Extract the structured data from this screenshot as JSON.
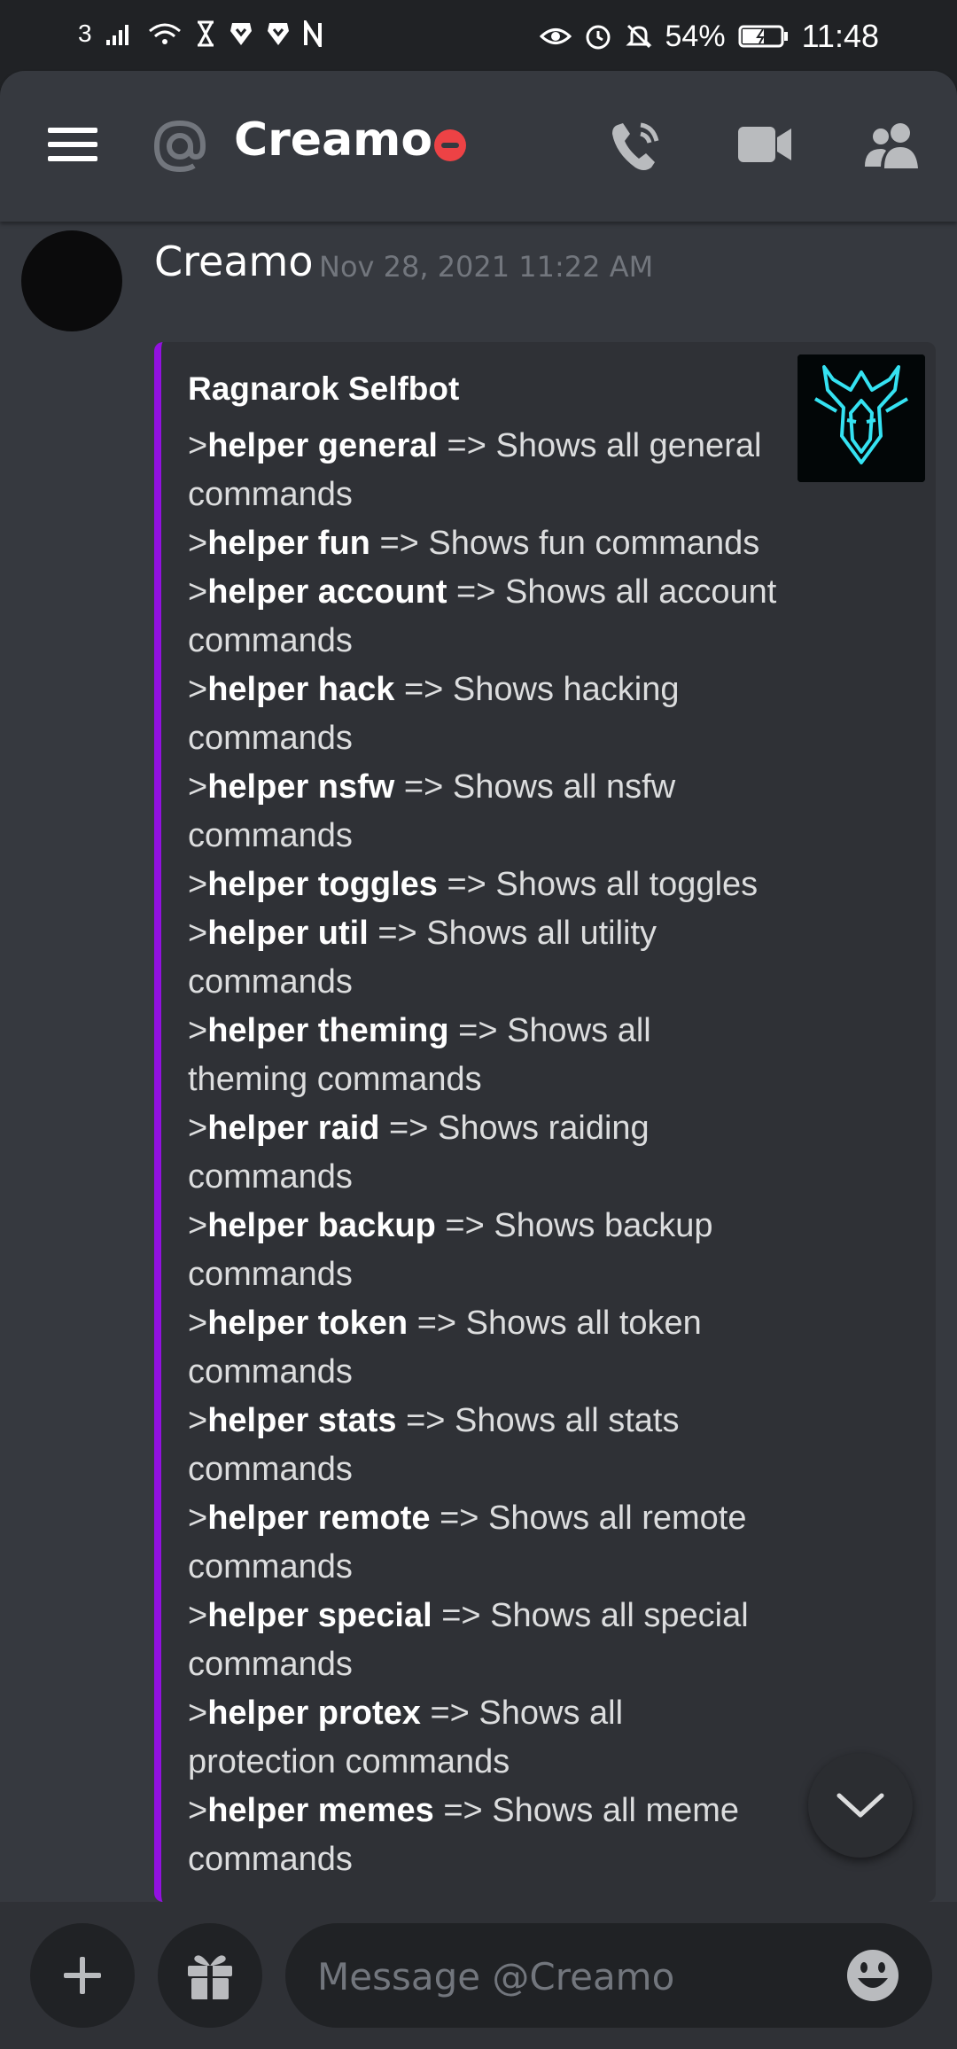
{
  "status_bar": {
    "sim": "3",
    "battery_percent": "54%",
    "time": "11:48"
  },
  "header": {
    "title": "Creamo",
    "menu_icon": "hamburger-icon",
    "at_icon": "at-icon",
    "status": "do-not-disturb",
    "call_icon": "phone-call-icon",
    "video_icon": "video-camera-icon",
    "members_icon": "members-icon"
  },
  "message": {
    "author": "Creamo",
    "timestamp": "Nov 28, 2021 11:22 AM",
    "embed": {
      "accent_color": "#9211e0",
      "title": "Ragnarok Selfbot",
      "lines": [
        {
          "prefix": ">",
          "command": "helper general",
          "desc": " => Shows all general",
          "wrap": "commands"
        },
        {
          "prefix": ">",
          "command": "helper fun",
          "desc": " => Shows fun commands",
          "wrap": ""
        },
        {
          "prefix": ">",
          "command": "helper account",
          "desc": " => Shows all account",
          "wrap": "commands"
        },
        {
          "prefix": ">",
          "command": "helper hack",
          "desc": " => Shows hacking",
          "wrap": "commands"
        },
        {
          "prefix": ">",
          "command": "helper nsfw",
          "desc": " => Shows all nsfw",
          "wrap": "commands"
        },
        {
          "prefix": ">",
          "command": "helper toggles",
          "desc": " => Shows all toggles",
          "wrap": ""
        },
        {
          "prefix": ">",
          "command": "helper util",
          "desc": " => Shows all utility",
          "wrap": "commands"
        },
        {
          "prefix": ">",
          "command": "helper theming",
          "desc": " => Shows all",
          "wrap": "theming commands"
        },
        {
          "prefix": ">",
          "command": "helper raid",
          "desc": " => Shows raiding",
          "wrap": "commands"
        },
        {
          "prefix": ">",
          "command": "helper backup",
          "desc": " => Shows backup",
          "wrap": "commands"
        },
        {
          "prefix": ">",
          "command": "helper token",
          "desc": " => Shows all token",
          "wrap": "commands"
        },
        {
          "prefix": ">",
          "command": "helper stats",
          "desc": " => Shows all stats",
          "wrap": "commands"
        },
        {
          "prefix": ">",
          "command": "helper remote",
          "desc": " => Shows all remote",
          "wrap": "commands"
        },
        {
          "prefix": ">",
          "command": "helper special",
          "desc": " => Shows all special",
          "wrap": "commands"
        },
        {
          "prefix": ">",
          "command": "helper protex",
          "desc": " => Shows all",
          "wrap": "protection commands"
        },
        {
          "prefix": ">",
          "command": "helper memes",
          "desc": " => Shows all meme",
          "wrap": "commands"
        }
      ]
    }
  },
  "composer": {
    "add_icon": "plus-icon",
    "gift_icon": "gift-icon",
    "placeholder": "Message @Creamo",
    "emoji_icon": "emoji-icon"
  },
  "scroll_down_icon": "chevron-down-icon"
}
